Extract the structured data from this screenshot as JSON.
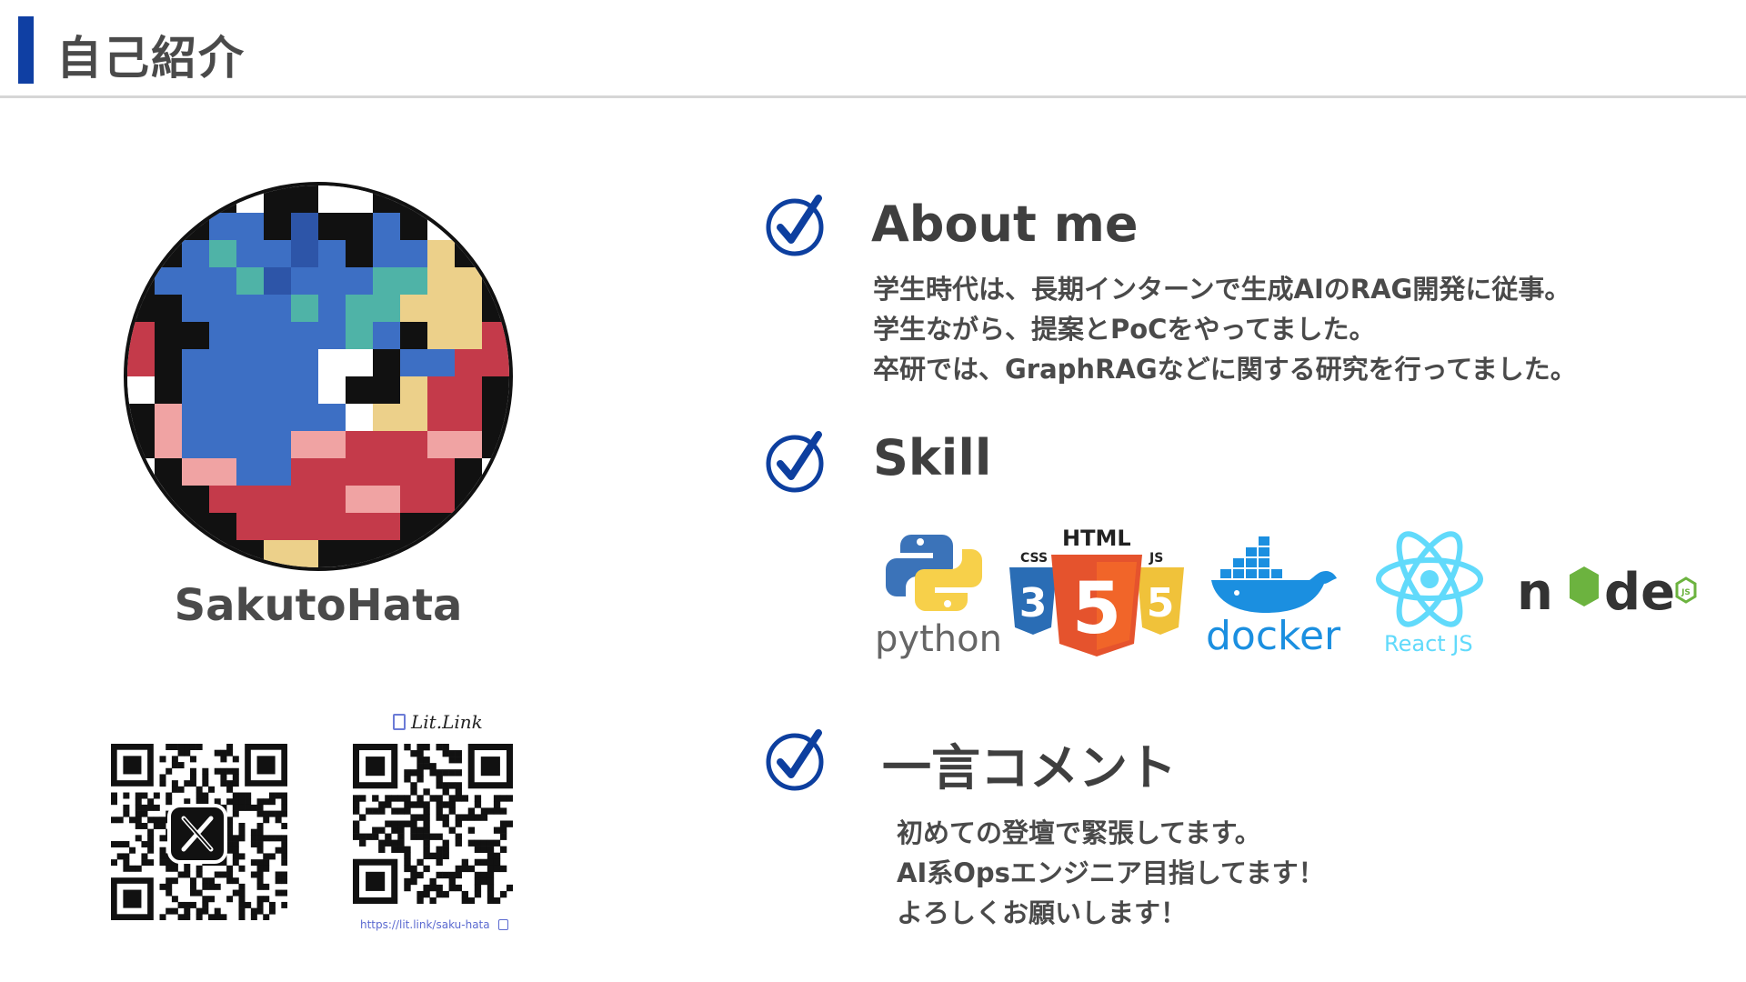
{
  "header": {
    "title": "自己紹介"
  },
  "profile": {
    "name": "SakutoHata"
  },
  "links": {
    "litlink_label": "Lit.Link",
    "litlink_url": "https://lit.link/saku-hata"
  },
  "sections": {
    "about": {
      "title": "About  me",
      "lines": [
        "学生時代は、長期インターンで生成AIのRAG開発に従事。",
        "学生ながら、提案とPoCをやってました。",
        "卒研では、GraphRAGなどに関する研究を行ってました。"
      ]
    },
    "skill": {
      "title": "Skill",
      "logos": {
        "python": "python",
        "html": "HTML",
        "css": "CSS",
        "js": "JS",
        "docker": "docker",
        "react": "React JS",
        "node": "node"
      }
    },
    "comment": {
      "title": "一言コメント",
      "lines": [
        "初めての登壇で緊張してます。",
        "AI系Opsエンジニア目指してます！",
        "よろしくお願いします！"
      ]
    }
  },
  "colors": {
    "accent": "#0f3fa3",
    "check": "#0d3f9f",
    "python_blue": "#3b73b9",
    "python_yellow": "#f7d04a",
    "html_orange": "#e5532d",
    "css_blue": "#2a6db5",
    "js_yellow": "#f0c23a",
    "docker_blue": "#1b8fe0",
    "react_cyan": "#61dafb",
    "node_green": "#6cb33f"
  }
}
